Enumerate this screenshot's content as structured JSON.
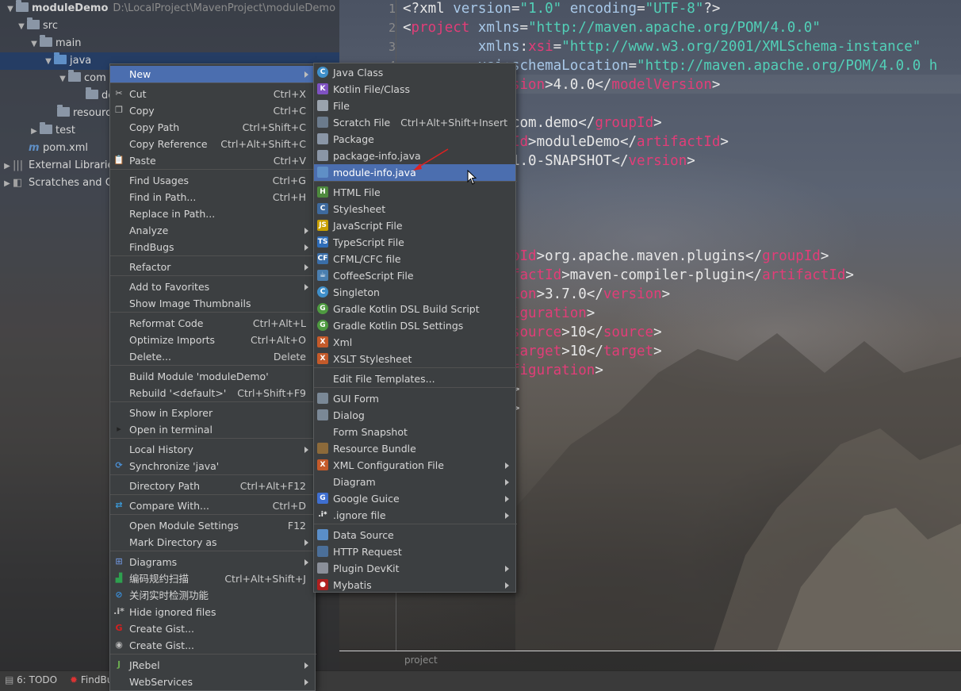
{
  "project_tree": {
    "rows": [
      {
        "label": "moduleDemo",
        "path": "D:\\LocalProject\\MavenProject\\moduleDemo"
      },
      {
        "label": "src"
      },
      {
        "label": "main"
      },
      {
        "label": "java"
      },
      {
        "label": "com"
      },
      {
        "label": "de"
      },
      {
        "label": "resourc"
      },
      {
        "label": "test"
      },
      {
        "label": "pom.xml"
      },
      {
        "label": "External Libraries"
      },
      {
        "label": "Scratches and C"
      }
    ]
  },
  "editor": {
    "line_numbers": [
      "1",
      "2",
      "3",
      "4"
    ],
    "breadcrumb": "project"
  },
  "bottom_bar": {
    "todo": "6: TODO",
    "findbugs": "FindBu"
  },
  "context_menu": {
    "items": [
      {
        "label": "New",
        "shortcut": ""
      },
      {
        "label": "Cut",
        "shortcut": "Ctrl+X"
      },
      {
        "label": "Copy",
        "shortcut": "Ctrl+C"
      },
      {
        "label": "Copy Path",
        "shortcut": "Ctrl+Shift+C"
      },
      {
        "label": "Copy Reference",
        "shortcut": "Ctrl+Alt+Shift+C"
      },
      {
        "label": "Paste",
        "shortcut": "Ctrl+V"
      },
      {
        "label": "Find Usages",
        "shortcut": "Ctrl+G"
      },
      {
        "label": "Find in Path...",
        "shortcut": "Ctrl+H"
      },
      {
        "label": "Replace in Path...",
        "shortcut": ""
      },
      {
        "label": "Analyze",
        "shortcut": ""
      },
      {
        "label": "FindBugs",
        "shortcut": ""
      },
      {
        "label": "Refactor",
        "shortcut": ""
      },
      {
        "label": "Add to Favorites",
        "shortcut": ""
      },
      {
        "label": "Show Image Thumbnails",
        "shortcut": ""
      },
      {
        "label": "Reformat Code",
        "shortcut": "Ctrl+Alt+L"
      },
      {
        "label": "Optimize Imports",
        "shortcut": "Ctrl+Alt+O"
      },
      {
        "label": "Delete...",
        "shortcut": "Delete"
      },
      {
        "label": "Build Module 'moduleDemo'",
        "shortcut": ""
      },
      {
        "label": "Rebuild '<default>'",
        "shortcut": "Ctrl+Shift+F9"
      },
      {
        "label": "Show in Explorer",
        "shortcut": ""
      },
      {
        "label": "Open in terminal",
        "shortcut": ""
      },
      {
        "label": "Local History",
        "shortcut": ""
      },
      {
        "label": "Synchronize 'java'",
        "shortcut": ""
      },
      {
        "label": "Directory Path",
        "shortcut": "Ctrl+Alt+F12"
      },
      {
        "label": "Compare With...",
        "shortcut": "Ctrl+D"
      },
      {
        "label": "Open Module Settings",
        "shortcut": "F12"
      },
      {
        "label": "Mark Directory as",
        "shortcut": ""
      },
      {
        "label": "Diagrams",
        "shortcut": ""
      },
      {
        "label": "编码规约扫描",
        "shortcut": "Ctrl+Alt+Shift+J"
      },
      {
        "label": "关闭实时检测功能",
        "shortcut": ""
      },
      {
        "label": "Hide ignored files",
        "shortcut": ""
      },
      {
        "label": "Create Gist...",
        "shortcut": ""
      },
      {
        "label": "Create Gist...",
        "shortcut": ""
      },
      {
        "label": "JRebel",
        "shortcut": ""
      },
      {
        "label": "WebServices",
        "shortcut": ""
      }
    ]
  },
  "new_submenu": {
    "items": [
      {
        "label": "Java Class",
        "shortcut": ""
      },
      {
        "label": "Kotlin File/Class",
        "shortcut": ""
      },
      {
        "label": "File",
        "shortcut": ""
      },
      {
        "label": "Scratch File",
        "shortcut": "Ctrl+Alt+Shift+Insert"
      },
      {
        "label": "Package",
        "shortcut": ""
      },
      {
        "label": "package-info.java",
        "shortcut": ""
      },
      {
        "label": "module-info.java",
        "shortcut": ""
      },
      {
        "label": "HTML File",
        "shortcut": ""
      },
      {
        "label": "Stylesheet",
        "shortcut": ""
      },
      {
        "label": "JavaScript File",
        "shortcut": ""
      },
      {
        "label": "TypeScript File",
        "shortcut": ""
      },
      {
        "label": "CFML/CFC file",
        "shortcut": ""
      },
      {
        "label": "CoffeeScript File",
        "shortcut": ""
      },
      {
        "label": "Singleton",
        "shortcut": ""
      },
      {
        "label": "Gradle Kotlin DSL Build Script",
        "shortcut": ""
      },
      {
        "label": "Gradle Kotlin DSL Settings",
        "shortcut": ""
      },
      {
        "label": "Xml",
        "shortcut": ""
      },
      {
        "label": "XSLT Stylesheet",
        "shortcut": ""
      },
      {
        "label": "Edit File Templates...",
        "shortcut": ""
      },
      {
        "label": "GUI Form",
        "shortcut": ""
      },
      {
        "label": "Dialog",
        "shortcut": ""
      },
      {
        "label": "Form Snapshot",
        "shortcut": ""
      },
      {
        "label": "Resource Bundle",
        "shortcut": ""
      },
      {
        "label": "XML Configuration File",
        "shortcut": ""
      },
      {
        "label": "Diagram",
        "shortcut": ""
      },
      {
        "label": "Google Guice",
        "shortcut": ""
      },
      {
        "label": ".ignore file",
        "shortcut": ""
      },
      {
        "label": "Data Source",
        "shortcut": ""
      },
      {
        "label": "HTTP Request",
        "shortcut": ""
      },
      {
        "label": "Plugin DevKit",
        "shortcut": ""
      },
      {
        "label": "Mybatis",
        "shortcut": ""
      }
    ]
  }
}
